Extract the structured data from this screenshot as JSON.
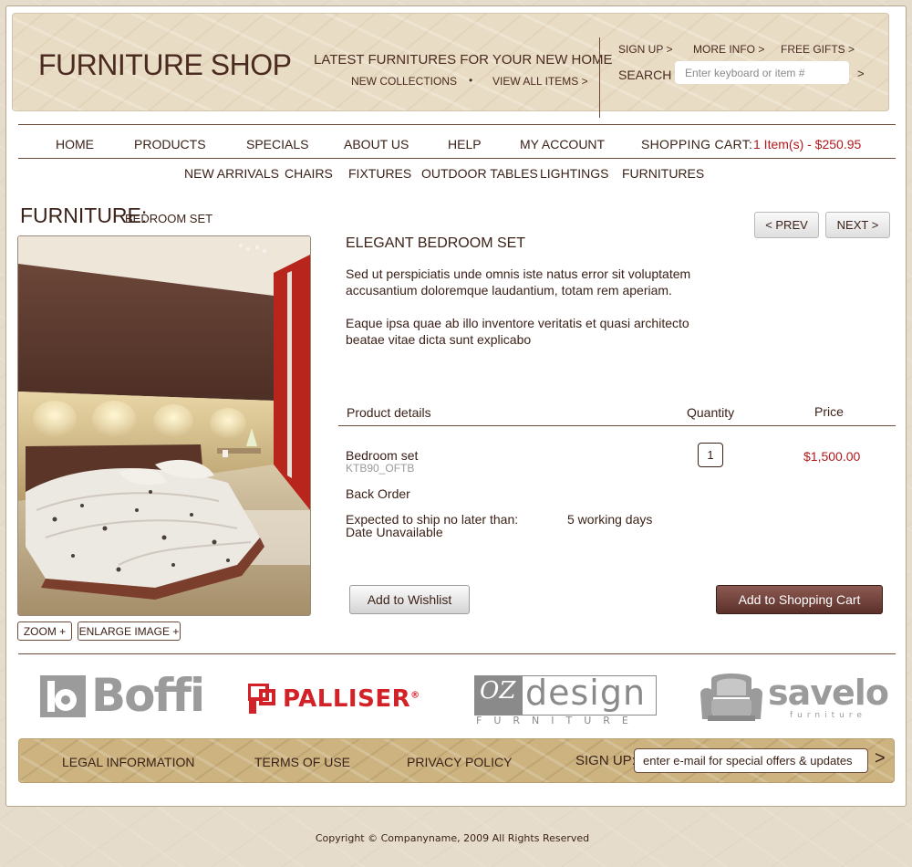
{
  "header": {
    "logo": "FURNITURE SHOP",
    "tagline": "LATEST FURNITURES FOR YOUR NEW HOME",
    "new_collections": "NEW COLLECTIONS",
    "bullet": "•",
    "view_all": "VIEW ALL ITEMS >",
    "top_links": [
      "SIGN UP >",
      "MORE INFO >",
      "FREE GIFTS >"
    ],
    "search_label": "SEARCH",
    "search_placeholder": "Enter keyboard or item #",
    "search_go": ">"
  },
  "nav": {
    "items": [
      "HOME",
      "PRODUCTS",
      "SPECIALS",
      "ABOUT US",
      "HELP",
      "MY ACCOUNT"
    ],
    "cart_label": "SHOPPING CART:",
    "cart_value": "1 Item(s) - $250.95",
    "sub_items": [
      "NEW ARRIVALS",
      "CHAIRS",
      "FIXTURES",
      "OUTDOOR TABLES",
      "LIGHTINGS",
      "FURNITURES"
    ]
  },
  "breadcrumb": {
    "main": "FURNITURE:",
    "sub": "BEDROOM SET"
  },
  "pager": {
    "prev": "< PREV",
    "next": "NEXT >"
  },
  "image_buttons": {
    "zoom": "ZOOM +",
    "enlarge": "ENLARGE IMAGE +"
  },
  "product": {
    "title": "ELEGANT BEDROOM SET",
    "desc1_line1": "Sed ut perspiciatis unde omnis iste natus error sit voluptatem",
    "desc1_line2": "accusantium doloremque laudantium, totam rem aperiam.",
    "desc2_line1": "Eaque ipsa quae ab illo inventore veritatis et quasi architecto",
    "desc2_line2": "beatae vitae dicta sunt explicabo"
  },
  "table": {
    "headers": {
      "details": "Product details",
      "quantity": "Quantity",
      "price": "Price"
    },
    "item_name": "Bedroom set",
    "sku": "KTB90_OFTB",
    "quantity": "1",
    "price": "$1,500.00",
    "status": "Back Order",
    "ship_label": "Expected to ship no later than:",
    "ship_value": "5 working days",
    "date_label": "Date  Unavailable"
  },
  "actions": {
    "wishlist": "Add to Wishlist",
    "cart": "Add to Shopping Cart"
  },
  "brands": {
    "boffi": "Boffi",
    "palliser": "PALLISER",
    "palliser_mark": "®",
    "oz_design_script": "OZ",
    "oz_design": "design",
    "oz_furniture": "FURNITURE",
    "savelo": "savelo",
    "savelo_sub": "furniture"
  },
  "footer": {
    "links": [
      "LEGAL INFORMATION",
      "TERMS OF USE",
      "PRIVACY POLICY"
    ],
    "signup_label": "SIGN UP:",
    "email_placeholder": "enter e-mail for special offers & updates",
    "email_go": ">"
  },
  "copyright": "Copyright © Companyname, 2009 All Rights Reserved",
  "colors": {
    "brand_brown": "#4b2a1f",
    "price_red": "#b0191b",
    "palliser_red": "#d32128",
    "logo_gray": "#9b9b9b"
  }
}
